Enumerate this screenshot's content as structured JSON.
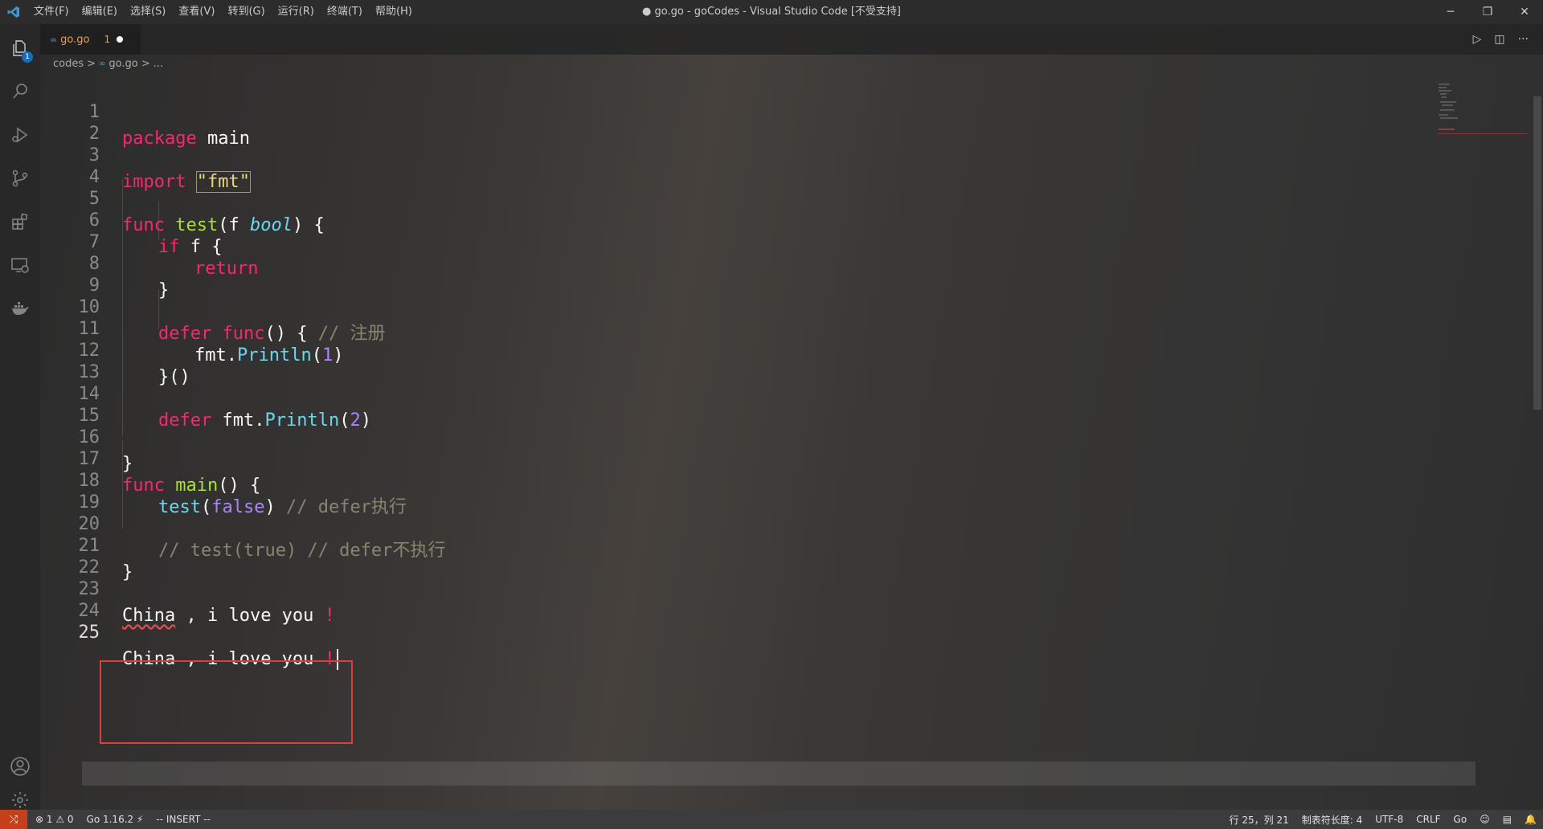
{
  "titlebar": {
    "menu": [
      "文件(F)",
      "编辑(E)",
      "选择(S)",
      "查看(V)",
      "转到(G)",
      "运行(R)",
      "终端(T)",
      "帮助(H)"
    ],
    "title": "● go.go - goCodes - Visual Studio Code [不受支持]",
    "controls": {
      "minimize": "─",
      "restore": "❐",
      "close": "✕"
    }
  },
  "activitybar": {
    "explorer_badge": "1",
    "icons": [
      "files-icon",
      "search-icon",
      "run-debug-icon",
      "source-control-icon",
      "extensions-icon",
      "remote-explorer-icon",
      "docker-icon",
      "account-icon",
      "settings-gear-icon"
    ]
  },
  "tab": {
    "icon": "∞",
    "name": "go.go",
    "problems": "1"
  },
  "editor_actions": {
    "run": "▷",
    "split": "◫",
    "more": "···"
  },
  "breadcrumb": {
    "folder": "codes",
    "sep": ">",
    "icon": "∞",
    "file": "go.go",
    "sep2": ">",
    "rest": "..."
  },
  "code": {
    "line_numbers": [
      "1",
      "2",
      "3",
      "4",
      "5",
      "6",
      "7",
      "8",
      "9",
      "10",
      "11",
      "12",
      "13",
      "14",
      "15",
      "16",
      "17",
      "18",
      "19",
      "20",
      "21",
      "22",
      "23",
      "24",
      "25"
    ],
    "t": {
      "package": "package",
      "main": " main",
      "import": "import",
      "fmt_str": "\"fmt\"",
      "func": "func",
      "test": "test",
      "paren_f": "(f ",
      "bool": "bool",
      "close_brace": ") {",
      "if": "if",
      "if_rest": " f {",
      "return": "return",
      "rbrace": "}",
      "defer": "defer",
      "func2": "func",
      "anon_open": "() { ",
      "cm_register": "// 注册",
      "fmt": "fmt.",
      "println": "Println",
      "lp": "(",
      "one": "1",
      "rp": ")",
      "anon_close": "}()",
      "two": "2",
      "main_name": "main",
      "main_open": "() {",
      "test_call": "test",
      "false": "false",
      "cm_defer_exec": "// defer执行",
      "cm_test_true": "// test(true) // defer不执行",
      "china": "China",
      "love": " , i love you ",
      "excl": "!"
    }
  },
  "statusbar": {
    "remote_icon": "⤭",
    "problems": "⊗ 1 ⚠ 0",
    "go_version": "Go 1.16.2 ⚡",
    "mode": "-- INSERT --",
    "position": "行 25，列 21",
    "tab_size": "制表符长度: 4",
    "encoding": "UTF-8",
    "eol": "CRLF",
    "language": "Go",
    "feedback_icon": "☺",
    "doc_icon": "▤",
    "bell_icon": "🔔"
  }
}
